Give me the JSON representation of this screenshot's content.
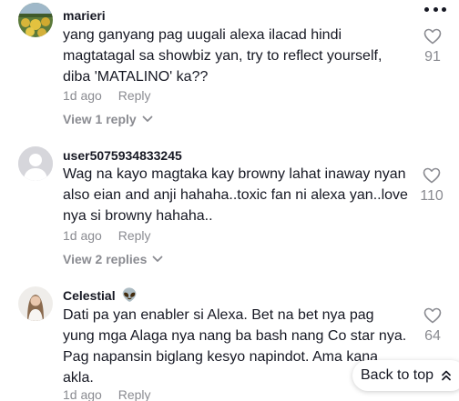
{
  "comments": [
    {
      "username": "marieri",
      "text": "yang ganyang pag uugali alexa ilacad hindi magtatagal sa showbiz yan, try to reflect yourself, diba 'MATALINO' ka??",
      "time": "1d ago",
      "reply_label": "Reply",
      "view_replies": "View 1 reply",
      "likes": "91"
    },
    {
      "username": "user5075934833245",
      "text": "Wag na kayo magtaka kay browny lahat inaway nyan also eian and anji hahaha..toxic fan ni alexa yan..love nya si browny hahaha..",
      "time": "1d ago",
      "reply_label": "Reply",
      "view_replies": "View 2 replies",
      "likes": "110"
    },
    {
      "username": "Celestial",
      "username_emoji": "👽",
      "text": "Dati pa yan enabler si Alexa. Bet na bet nya pag yung mga Alaga nya nang ba bash nang Co star nya. Pag napansin biglang kesyo napindot. Ama kana akla.",
      "time": "1d ago",
      "reply_label": "Reply",
      "likes": "64"
    }
  ],
  "back_to_top": "Back to top",
  "icons": {
    "more": "more-dots-icon",
    "like": "heart-outline-icon",
    "expand": "chevron-down-icon",
    "back_to_top": "chevron-double-up-icon"
  },
  "colors": {
    "text": "#161823",
    "muted": "#8a8b91",
    "background": "#ffffff"
  }
}
